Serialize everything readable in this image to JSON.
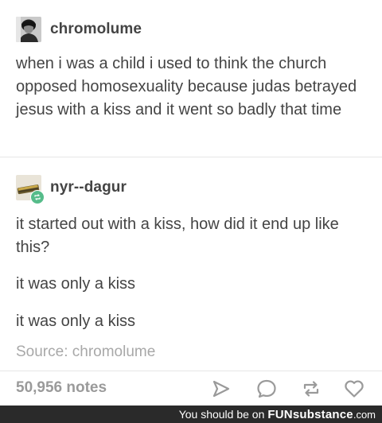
{
  "original_post": {
    "blog_name": "chromolume",
    "text": "when i was a child i used to think the church opposed homosexuality because judas betrayed jesus with a kiss and it went so badly that time",
    "avatar_icon": "person-photo-avatar"
  },
  "reblog": {
    "blog_name": "nyr--dagur",
    "avatar_icon": "harmonica-avatar",
    "badge_icon": "reblog-icon",
    "badge_color": "#56bc8a",
    "paragraphs": [
      "it started out with a kiss, how did it end up like this?",
      "it was only a kiss",
      "it was only a kiss"
    ]
  },
  "source": "Source: chromolume",
  "footer": {
    "notes": "50,956 notes",
    "actions": [
      "share-icon",
      "reply-icon",
      "reblog-icon",
      "like-icon"
    ]
  },
  "watermark": {
    "text": "You should be on",
    "brand": "FUNsubstance",
    "suffix": ".com"
  }
}
